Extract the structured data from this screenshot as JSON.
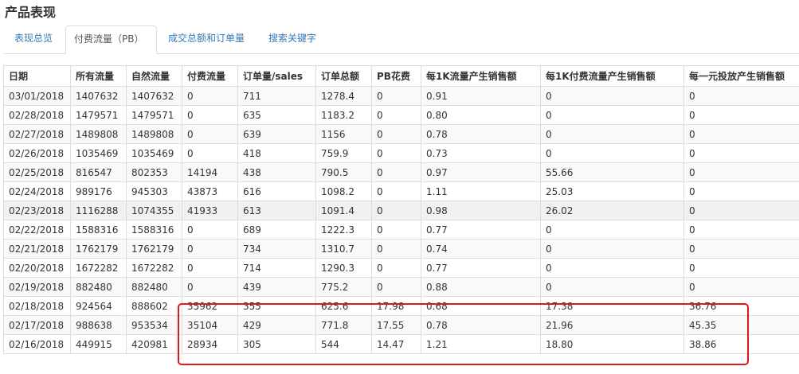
{
  "page": {
    "title": "产品表现"
  },
  "tabs": [
    {
      "label": "表现总览",
      "active": false
    },
    {
      "label": "付费流量（PB）",
      "active": true
    },
    {
      "label": "成交总额和订单量",
      "active": false
    },
    {
      "label": "搜索关键字",
      "active": false
    }
  ],
  "table": {
    "columns": [
      "日期",
      "所有流量",
      "自然流量",
      "付费流量",
      "订单量/sales",
      "订单总额",
      "PB花费",
      "每1K流量产生销售额",
      "每1K付费流量产生销售额",
      "每一元投放产生销售额"
    ],
    "rows": [
      [
        "03/01/2018",
        "1407632",
        "1407632",
        "0",
        "711",
        "1278.4",
        "0",
        "0.91",
        "0",
        "0"
      ],
      [
        "02/28/2018",
        "1479571",
        "1479571",
        "0",
        "635",
        "1183.2",
        "0",
        "0.80",
        "0",
        "0"
      ],
      [
        "02/27/2018",
        "1489808",
        "1489808",
        "0",
        "639",
        "1156",
        "0",
        "0.78",
        "0",
        "0"
      ],
      [
        "02/26/2018",
        "1035469",
        "1035469",
        "0",
        "418",
        "759.9",
        "0",
        "0.73",
        "0",
        "0"
      ],
      [
        "02/25/2018",
        "816547",
        "802353",
        "14194",
        "438",
        "790.5",
        "0",
        "0.97",
        "55.66",
        "0"
      ],
      [
        "02/24/2018",
        "989176",
        "945303",
        "43873",
        "616",
        "1098.2",
        "0",
        "1.11",
        "25.03",
        "0"
      ],
      [
        "02/23/2018",
        "1116288",
        "1074355",
        "41933",
        "613",
        "1091.4",
        "0",
        "0.98",
        "26.02",
        "0"
      ],
      [
        "02/22/2018",
        "1588316",
        "1588316",
        "0",
        "689",
        "1222.3",
        "0",
        "0.77",
        "0",
        "0"
      ],
      [
        "02/21/2018",
        "1762179",
        "1762179",
        "0",
        "734",
        "1310.7",
        "0",
        "0.74",
        "0",
        "0"
      ],
      [
        "02/20/2018",
        "1672282",
        "1672282",
        "0",
        "714",
        "1290.3",
        "0",
        "0.77",
        "0",
        "0"
      ],
      [
        "02/19/2018",
        "882480",
        "882480",
        "0",
        "439",
        "775.2",
        "0",
        "0.88",
        "0",
        "0"
      ],
      [
        "02/18/2018",
        "924564",
        "888602",
        "35962",
        "355",
        "625.6",
        "17.98",
        "0.68",
        "17.38",
        "36.76"
      ],
      [
        "02/17/2018",
        "988638",
        "953534",
        "35104",
        "429",
        "771.8",
        "17.55",
        "0.78",
        "21.96",
        "45.35"
      ],
      [
        "02/16/2018",
        "449915",
        "420981",
        "28934",
        "305",
        "544",
        "14.47",
        "1.21",
        "18.80",
        "38.86"
      ]
    ],
    "hover_row_index": 6
  },
  "colors": {
    "link": "#337ab7",
    "border": "#dddddd",
    "stripe": "#f9f9f9",
    "highlight": "#e21818"
  }
}
